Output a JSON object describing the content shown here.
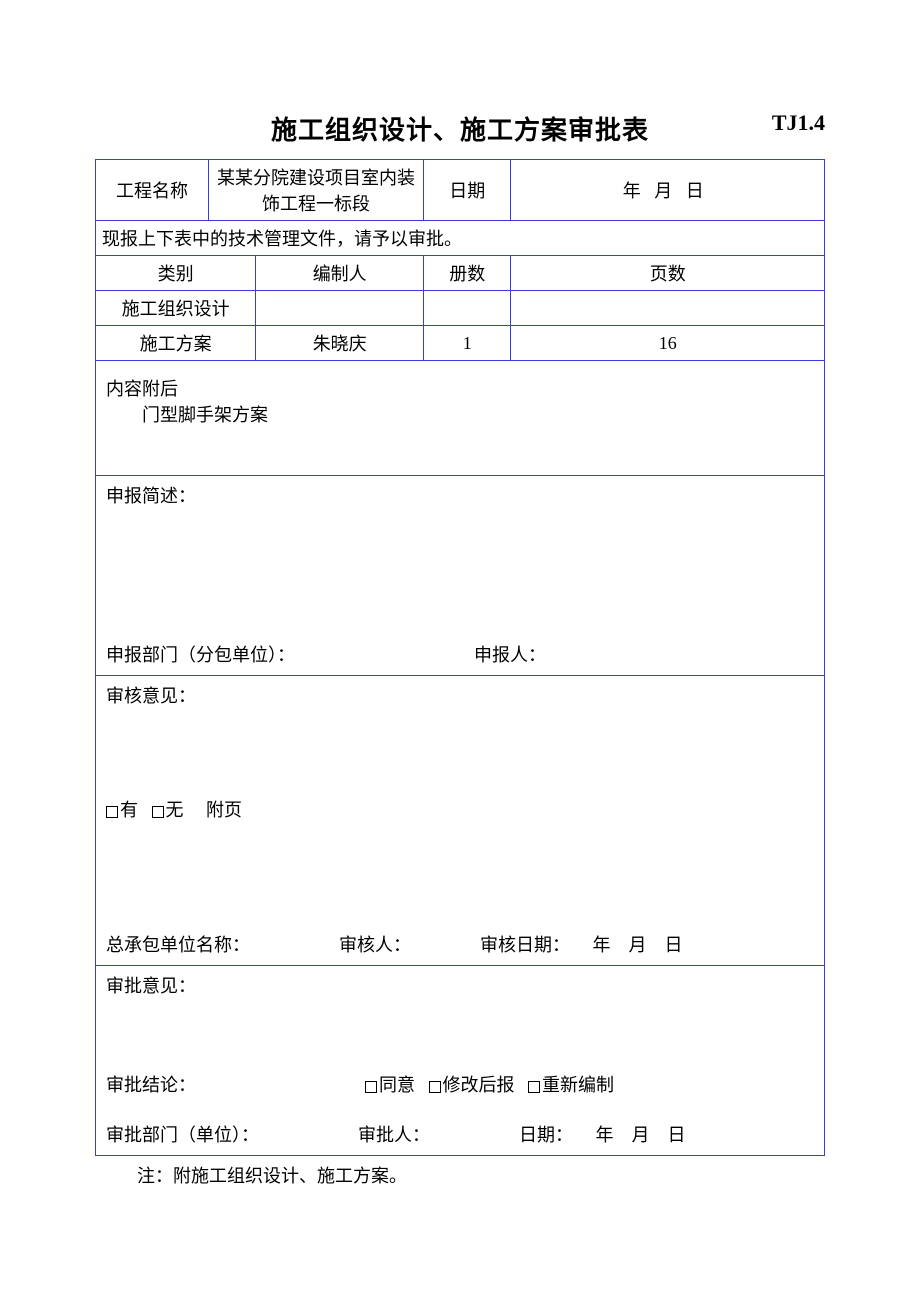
{
  "header": {
    "title": "施工组织设计、施工方案审批表",
    "code": "TJ1.4"
  },
  "row1": {
    "project_label": "工程名称",
    "project_value": "某某分院建设项目室内装饰工程一标段",
    "date_label": "日期",
    "date_year": "年",
    "date_month": "月",
    "date_day": "日"
  },
  "intro": "现报上下表中的技术管理文件，请予以审批。",
  "thead": {
    "category": "类别",
    "author": "编制人",
    "volumes": "册数",
    "pages": "页数"
  },
  "r1": {
    "category": "施工组织设计",
    "author": "",
    "volumes": "",
    "pages": ""
  },
  "r2": {
    "category": "施工方案",
    "author": "朱晓庆",
    "volumes": "1",
    "pages": "16"
  },
  "attach": {
    "label": "内容附后",
    "content": "门型脚手架方案"
  },
  "brief": {
    "label": "申报简述：",
    "dept_label": "申报部门（分包单位）：",
    "person_label": "申报人："
  },
  "review": {
    "label": "审核意见：",
    "has": "有",
    "none": "无",
    "attach": "附页",
    "unit_label": "总承包单位名称：",
    "reviewer_label": "审核人：",
    "date_label": "审核日期：",
    "year": "年",
    "month": "月",
    "day": "日"
  },
  "approve": {
    "label": "审批意见：",
    "conclusion_label": "审批结论：",
    "agree": "同意",
    "revise": "修改后报",
    "redo": "重新编制",
    "dept_label": "审批部门（单位）：",
    "approver_label": "审批人：",
    "date_label": "日期：",
    "year": "年",
    "month": "月",
    "day": "日"
  },
  "note": "注：附施工组织设计、施工方案。"
}
